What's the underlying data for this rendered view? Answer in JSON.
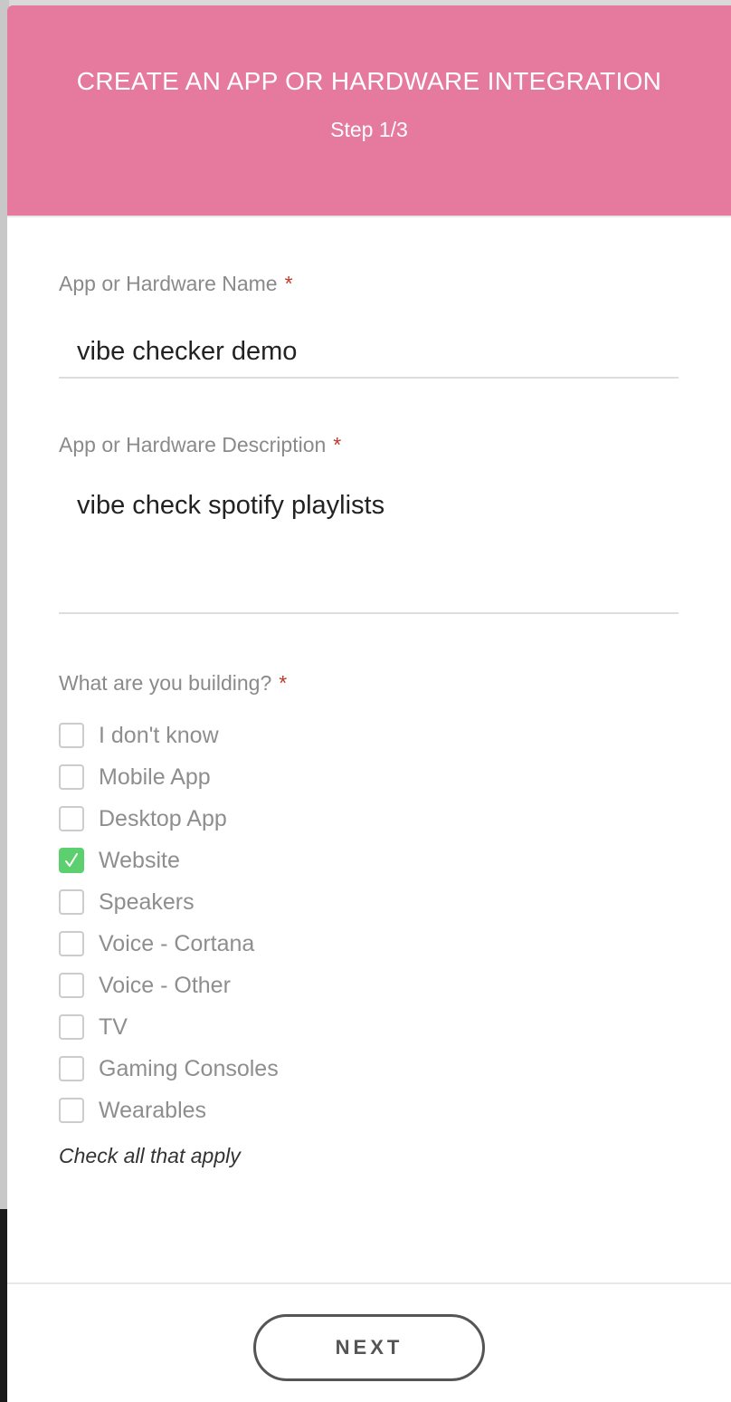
{
  "header": {
    "title": "CREATE AN APP OR HARDWARE INTEGRATION",
    "step": "Step 1/3"
  },
  "form": {
    "name": {
      "label": "App or Hardware Name",
      "required_mark": "*",
      "value": "vibe checker demo"
    },
    "description": {
      "label": "App or Hardware Description",
      "required_mark": "*",
      "value": "vibe check spotify playlists"
    },
    "building": {
      "label": "What are you building?",
      "required_mark": "*",
      "options": [
        {
          "label": "I don't know",
          "checked": false
        },
        {
          "label": "Mobile App",
          "checked": false
        },
        {
          "label": "Desktop App",
          "checked": false
        },
        {
          "label": "Website",
          "checked": true
        },
        {
          "label": "Speakers",
          "checked": false
        },
        {
          "label": "Voice - Cortana",
          "checked": false
        },
        {
          "label": "Voice - Other",
          "checked": false
        },
        {
          "label": "TV",
          "checked": false
        },
        {
          "label": "Gaming Consoles",
          "checked": false
        },
        {
          "label": "Wearables",
          "checked": false
        }
      ],
      "hint": "Check all that apply"
    }
  },
  "footer": {
    "next_label": "NEXT"
  },
  "colors": {
    "header_bg": "#e57a9e",
    "checked": "#5ccf6e",
    "required": "#c0392b"
  }
}
